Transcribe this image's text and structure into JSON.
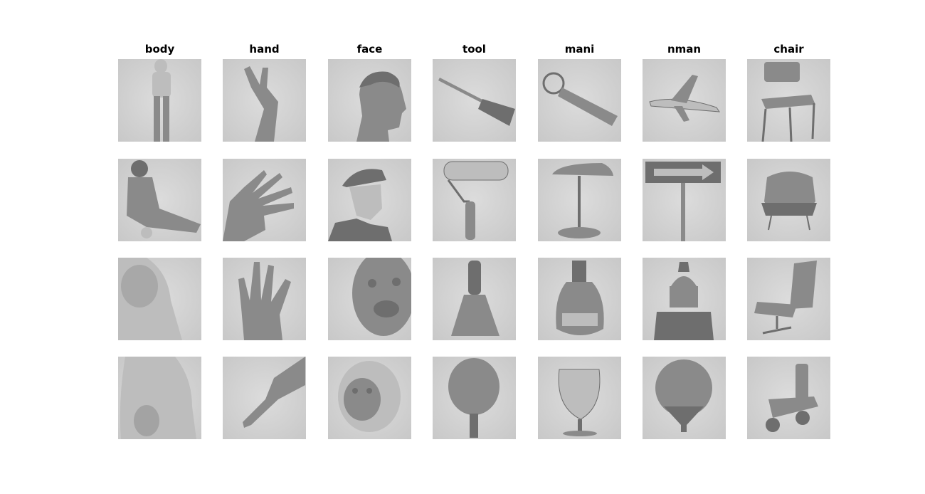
{
  "figure": {
    "columns": [
      {
        "title": "body"
      },
      {
        "title": "hand"
      },
      {
        "title": "face"
      },
      {
        "title": "tool"
      },
      {
        "title": "mani"
      },
      {
        "title": "nman"
      },
      {
        "title": "chair"
      }
    ],
    "rows": [
      [
        "standing-person",
        "human-hand-gesture",
        "man-profile-face",
        "wooden-spatula",
        "keychain",
        "airplane",
        "chair-with-handle"
      ],
      [
        "sitting-woman",
        "open-human-hand",
        "man-in-flat-cap",
        "paint-roller",
        "desk-lamp",
        "arrow-road-sign",
        "armchair"
      ],
      [
        "monkey-body",
        "monkey-hand",
        "monkey-face-closeup",
        "putty-knife",
        "liqueur-bottle",
        "church-tower",
        "office-lounge-chair"
      ],
      [
        "monkey-torso",
        "monkey-paw",
        "macaque-face",
        "table-tennis-paddle",
        "wine-glass",
        "hot-air-balloon",
        "wooden-chair"
      ]
    ],
    "colors": {
      "background": "#ffffff",
      "title_text": "#000000",
      "tile_base": "#d4d4d4"
    }
  }
}
